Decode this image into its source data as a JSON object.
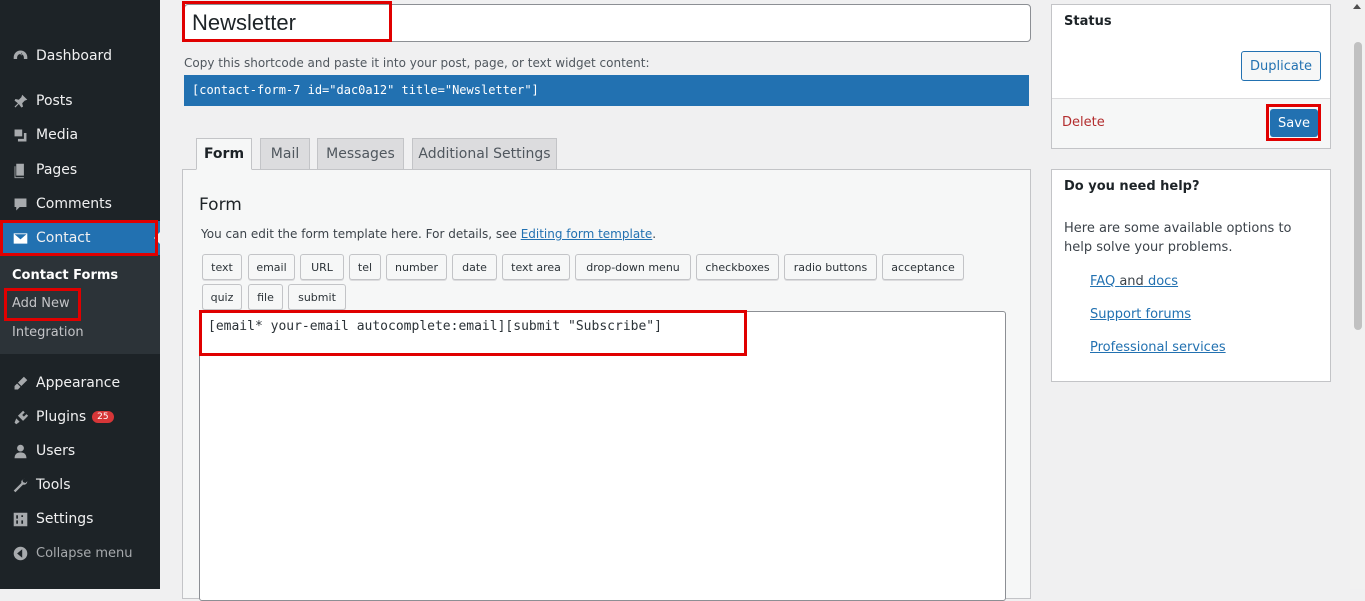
{
  "sidebar": {
    "dashboard": "Dashboard",
    "posts": "Posts",
    "media": "Media",
    "pages": "Pages",
    "comments": "Comments",
    "contact": "Contact",
    "contact_forms": "Contact Forms",
    "add_new": "Add New",
    "integration": "Integration",
    "appearance": "Appearance",
    "plugins": "Plugins",
    "plugins_badge": "25",
    "users": "Users",
    "tools": "Tools",
    "settings": "Settings",
    "collapse": "Collapse menu"
  },
  "editor": {
    "title_value": "Newsletter",
    "shortcode_hint": "Copy this shortcode and paste it into your post, page, or text widget content:",
    "shortcode": "[contact-form-7 id=\"dac0a12\" title=\"Newsletter\"]",
    "tabs": [
      "Form",
      "Mail",
      "Messages",
      "Additional Settings"
    ],
    "form_heading": "Form",
    "form_desc_prefix": "You can edit the form template here. For details, see ",
    "form_desc_link": "Editing form template",
    "form_desc_suffix": ".",
    "tag_buttons": [
      "text",
      "email",
      "URL",
      "tel",
      "number",
      "date",
      "text area",
      "drop-down menu",
      "checkboxes",
      "radio buttons",
      "acceptance",
      "quiz",
      "file",
      "submit"
    ],
    "template": "[email* your-email autocomplete:email][submit \"Subscribe\"]"
  },
  "status_box": {
    "title": "Status",
    "duplicate": "Duplicate",
    "delete": "Delete",
    "save": "Save"
  },
  "help_box": {
    "title": "Do you need help?",
    "text": "Here are some available options to help solve your problems.",
    "faq": "FAQ",
    "and": "and",
    "docs": "docs",
    "support": "Support forums",
    "professional": "Professional services"
  },
  "colors": {
    "accent": "#2271b1",
    "sidebar_bg": "#1d2327",
    "highlight": "#e00000",
    "delete": "#b32d2e"
  }
}
